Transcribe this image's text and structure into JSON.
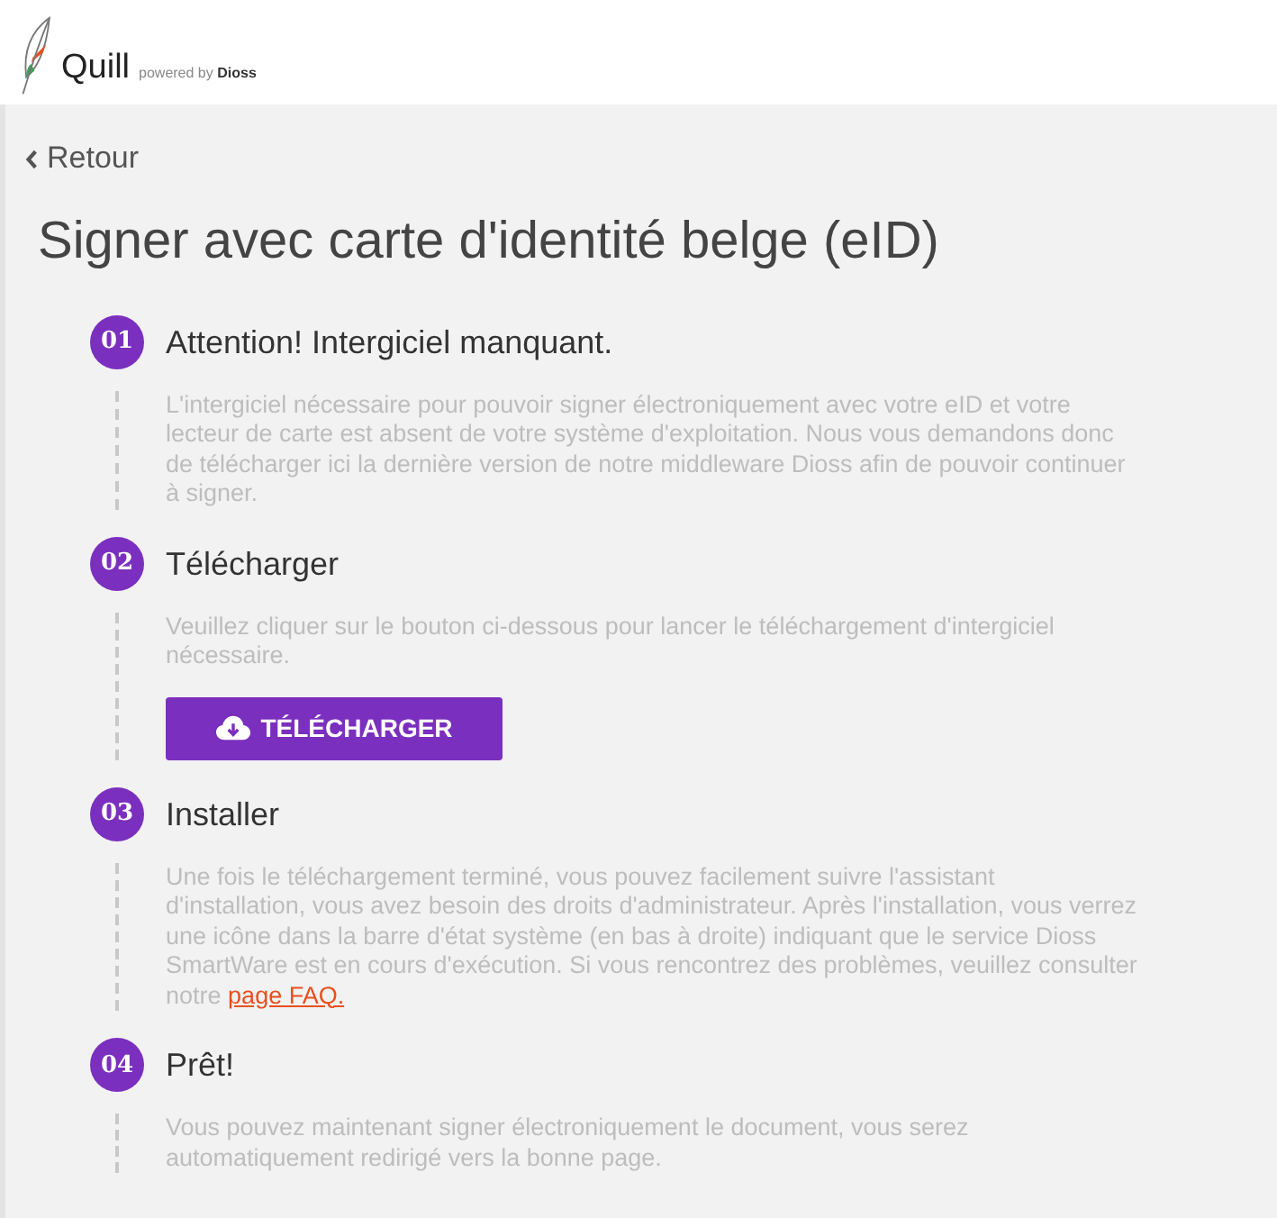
{
  "header": {
    "logo_text": "Quill",
    "powered_by": "powered by **Dioss**"
  },
  "back_link": {
    "label": "Retour"
  },
  "title": "Signer avec carte d'identité belge (eID)",
  "steps": [
    {
      "number": "01",
      "title": "Attention! Intergiciel manquant.",
      "text": "L'intergiciel nécessaire pour pouvoir signer électroniquement avec votre eID et votre lecteur de carte est absent de votre système d'exploitation. Nous vous demandons donc de télécharger ici la dernière version de notre middleware Dioss afin de pouvoir continuer à signer."
    },
    {
      "number": "02",
      "title": "Télécharger",
      "text": "Veuillez cliquer sur le bouton ci-dessous pour lancer le téléchargement d'intergiciel nécessaire.",
      "button": {
        "label": "TÉLÉCHARGER"
      }
    },
    {
      "number": "03",
      "title": "Installer",
      "text": "Une fois le téléchargement terminé, vous pouvez facilement suivre l'assistant d'installation, vous avez besoin des droits d'administrateur. Après l'installation, vous verrez une icône dans la barre d'état système (en bas à droite) indiquant que le service Dioss SmartWare est en cours d'exécution. Si vous rencontrez des problèmes, veuillez consulter notre",
      "link": "page FAQ."
    },
    {
      "number": "04",
      "title": "Prêt!",
      "text": "Vous pouvez maintenant signer électroniquement le document, vous serez automatiquement redirigé vers la bonne page."
    }
  ]
}
